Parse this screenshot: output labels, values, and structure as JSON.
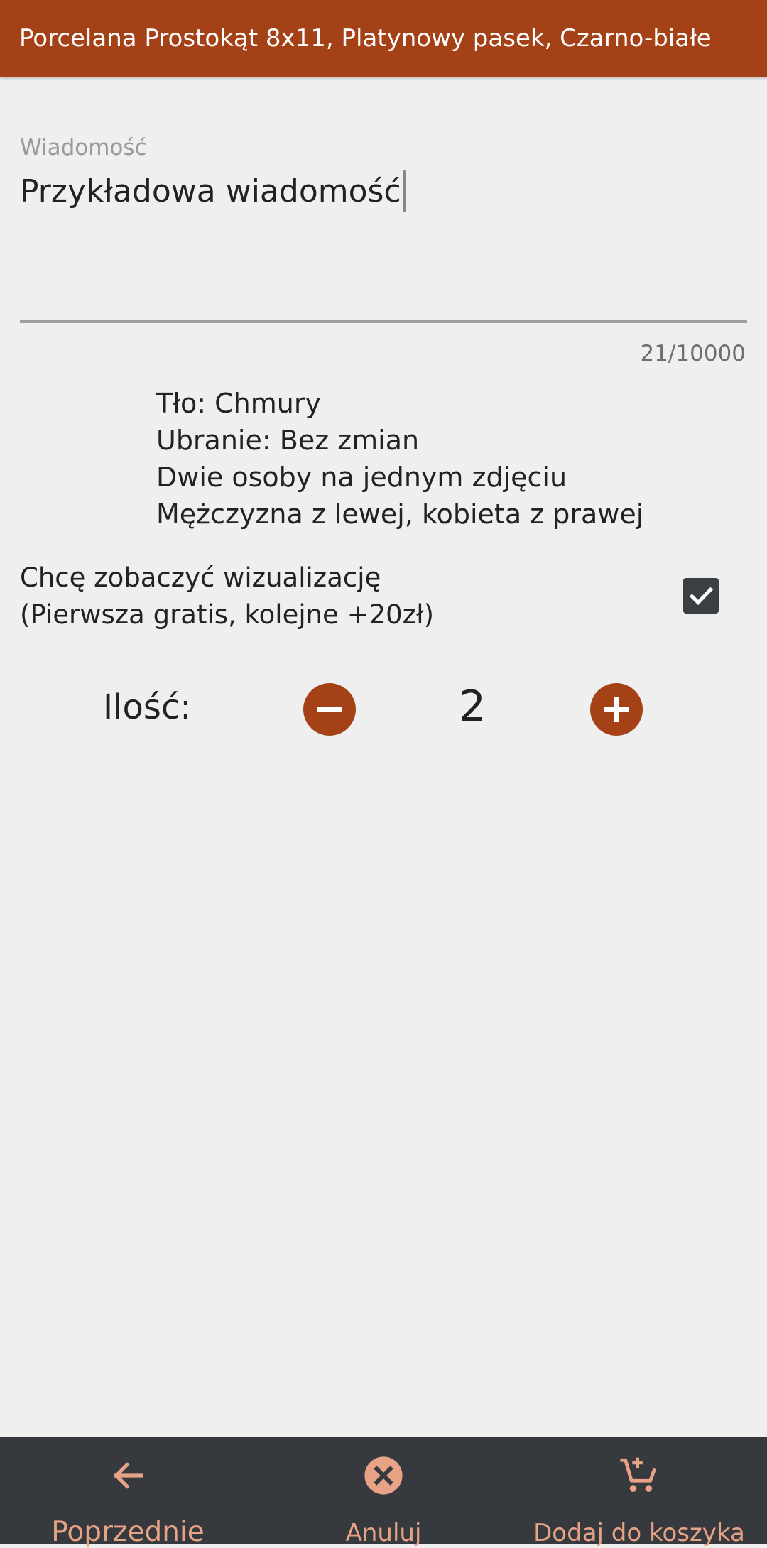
{
  "header": {
    "title": "Porcelana Prostokąt 8x11, Platynowy pasek, Czarno-białe"
  },
  "message_field": {
    "label": "Wiadomość",
    "value": "Przykładowa wiadomość",
    "counter": "21/10000"
  },
  "summary": {
    "lines": [
      "Tło: Chmury",
      "Ubranie: Bez zmian",
      "Dwie osoby na jednym zdjęciu",
      "Mężczyzna z lewej, kobieta z prawej"
    ]
  },
  "visualization": {
    "line1": "Chcę zobaczyć wizualizację",
    "line2": "(Pierwsza gratis, kolejne +20zł)",
    "checked": true
  },
  "quantity": {
    "label": "Ilość:",
    "value": "2",
    "decrease_icon": "minus-circle-icon",
    "increase_icon": "plus-circle-icon"
  },
  "bottom_nav": {
    "items": [
      {
        "label": "Poprzednie",
        "icon": "arrow-back-icon"
      },
      {
        "label": "Anuluj",
        "icon": "cancel-circle-icon"
      },
      {
        "label": "Dodaj do koszyka",
        "icon": "add-shopping-cart-icon"
      }
    ]
  },
  "colors": {
    "primary": "#a44116",
    "background": "#efefef",
    "nav_background": "#363a3e",
    "nav_accent": "#e8a386",
    "checkbox": "#3b3f43"
  }
}
